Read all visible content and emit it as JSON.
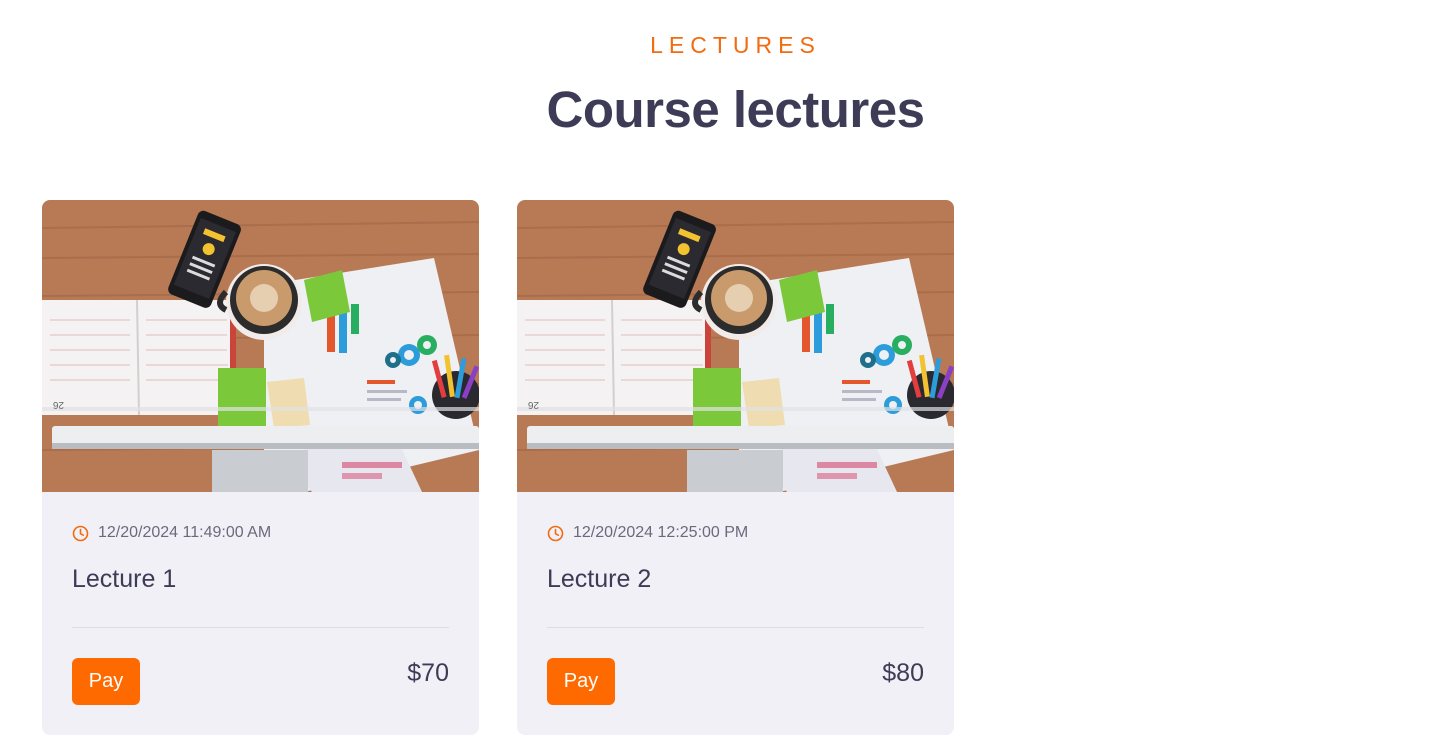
{
  "section": {
    "eyebrow": "LECTURES",
    "title": "Course lectures"
  },
  "theme": {
    "accent": "#ff6a00",
    "heading": "#3d3b55",
    "card_bg": "#f1f0f7"
  },
  "lectures": [
    {
      "datetime": "12/20/2024 11:49:00 AM",
      "name": "Lecture 1",
      "action_label": "Pay",
      "price": "$70",
      "icon": "clock-icon",
      "image": "desk-workspace-photo"
    },
    {
      "datetime": "12/20/2024 12:25:00 PM",
      "name": "Lecture 2",
      "action_label": "Pay",
      "price": "$80",
      "icon": "clock-icon",
      "image": "desk-workspace-photo"
    }
  ]
}
